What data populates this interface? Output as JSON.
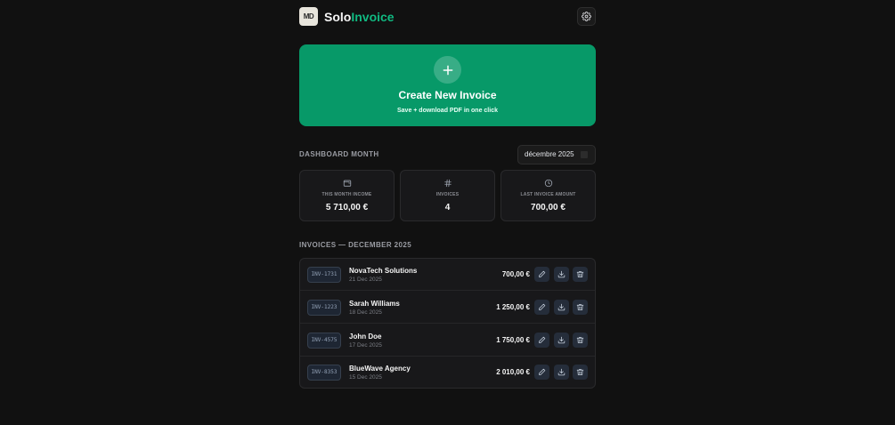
{
  "header": {
    "logo_text": "MD",
    "brand_part1": "Solo",
    "brand_part2": "Invoice",
    "settings_icon": "gear-icon"
  },
  "hero": {
    "title": "Create New Invoice",
    "subtitle": "Save + download PDF in one click",
    "icon": "plus-icon",
    "color": "#079968"
  },
  "dashboard": {
    "label": "DASHBOARD MONTH",
    "month_value": "décembre 2025"
  },
  "stats": [
    {
      "label": "THIS MONTH INCOME",
      "value": "5 710,00 €",
      "icon": "wallet-icon"
    },
    {
      "label": "INVOICES",
      "value": "4",
      "icon": "hash-icon"
    },
    {
      "label": "LAST INVOICE AMOUNT",
      "value": "700,00 €",
      "icon": "clock-icon"
    }
  ],
  "invoices": {
    "label": "INVOICES — DECEMBER 2025",
    "rows": [
      {
        "id": "INV-1731",
        "client": "NovaTech Solutions",
        "date": "21 Dec 2025",
        "amount": "700,00 €"
      },
      {
        "id": "INV-1223",
        "client": "Sarah Williams",
        "date": "18 Dec 2025",
        "amount": "1 250,00 €"
      },
      {
        "id": "INV-4575",
        "client": "John Doe",
        "date": "17 Dec 2025",
        "amount": "1 750,00 €"
      },
      {
        "id": "INV-8353",
        "client": "BlueWave Agency",
        "date": "15 Dec 2025",
        "amount": "2 010,00 €"
      }
    ]
  },
  "colors": {
    "background": "#111111",
    "accent": "#10b981",
    "card": "#18181a"
  }
}
